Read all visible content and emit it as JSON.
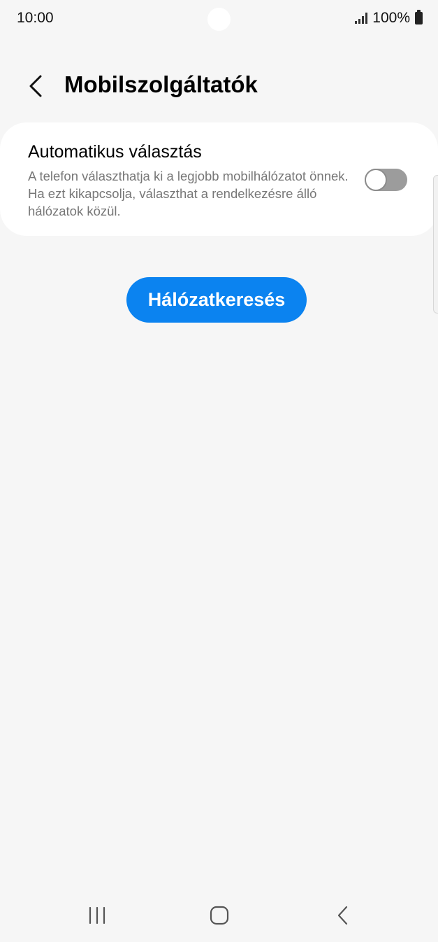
{
  "status_bar": {
    "time": "10:00",
    "battery_percent": "100%",
    "icons": [
      "signal-icon",
      "battery-icon"
    ]
  },
  "header": {
    "back_icon": "chevron-left-icon",
    "title": "Mobilszolgáltatók"
  },
  "auto_select": {
    "title": "Automatikus választás",
    "description": "A telefon választhatja ki a legjobb mobilhálózatot önnek. Ha ezt kikapcsolja, választhat a rendelkezésre álló hálózatok közül.",
    "enabled": false
  },
  "search_button": {
    "label": "Hálózatkeresés"
  },
  "nav_bar": {
    "icons": [
      "recent-apps-icon",
      "home-icon",
      "back-icon"
    ]
  },
  "colors": {
    "accent": "#0b83f0",
    "background": "#f6f6f6",
    "card": "#ffffff",
    "toggle_off_track": "#9c9c9c"
  }
}
